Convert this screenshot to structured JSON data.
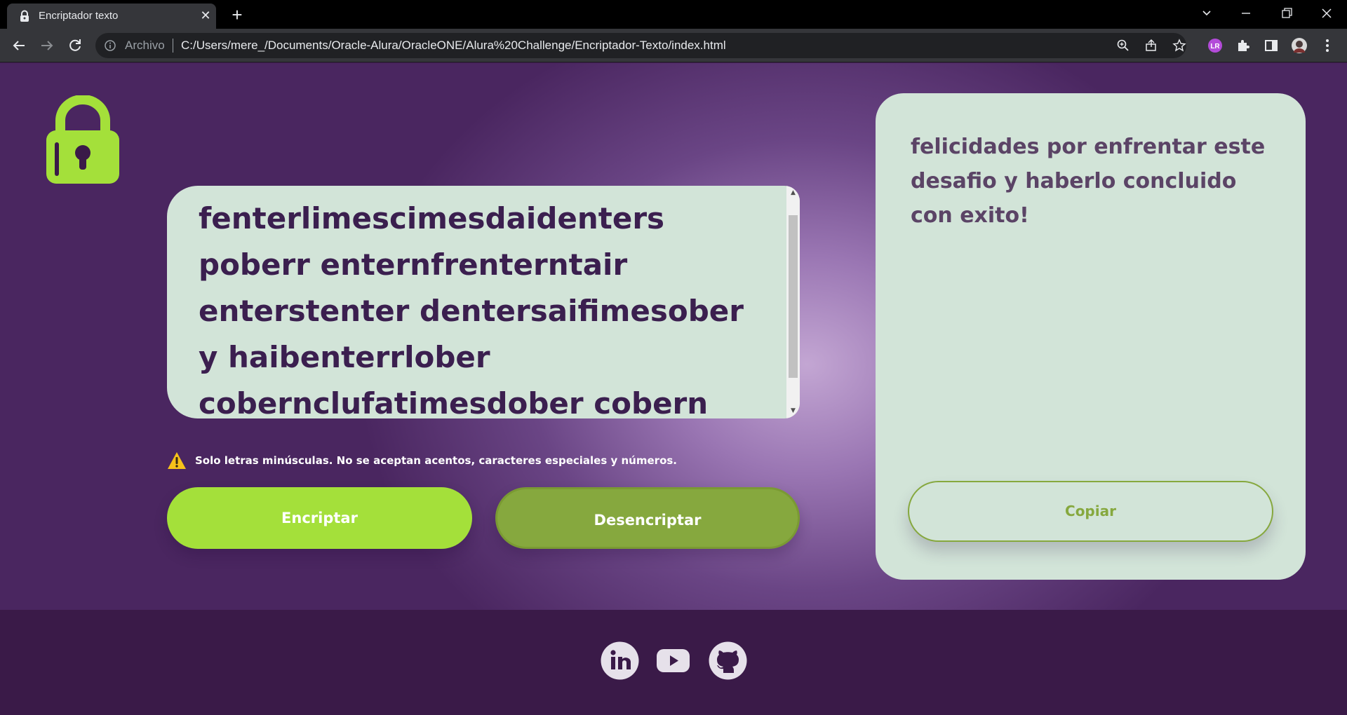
{
  "browser": {
    "tab_title": "Encriptador texto",
    "address_label": "Archivo",
    "url": "C:/Users/mere_/Documents/Oracle-Alura/OracleONE/Alura%20Challenge/Encriptador-Texto/index.html"
  },
  "page": {
    "input_text": "fenterlimescimesdaidenters poberr enternfrenterntair enterstenter dentersaifimesober y haibenterrlober cobernclufatimesdober cobern enterximestober!",
    "warning": "Solo letras minúsculas. No se aceptan acentos, caracteres especiales y números.",
    "encrypt_label": "Encriptar",
    "decrypt_label": "Desencriptar",
    "output_text": "felicidades por enfrentar este desafio y haberlo concluido con exito!",
    "copy_label": "Copiar"
  },
  "footer": {
    "icons": [
      "linkedin-icon",
      "youtube-icon",
      "github-icon"
    ]
  },
  "colors": {
    "primary_green": "#a4e03a",
    "secondary_green": "#86a83e",
    "panel": "#d2e4d8",
    "purple_dark": "#3a1a48",
    "text_purple": "#3b1f4f"
  }
}
